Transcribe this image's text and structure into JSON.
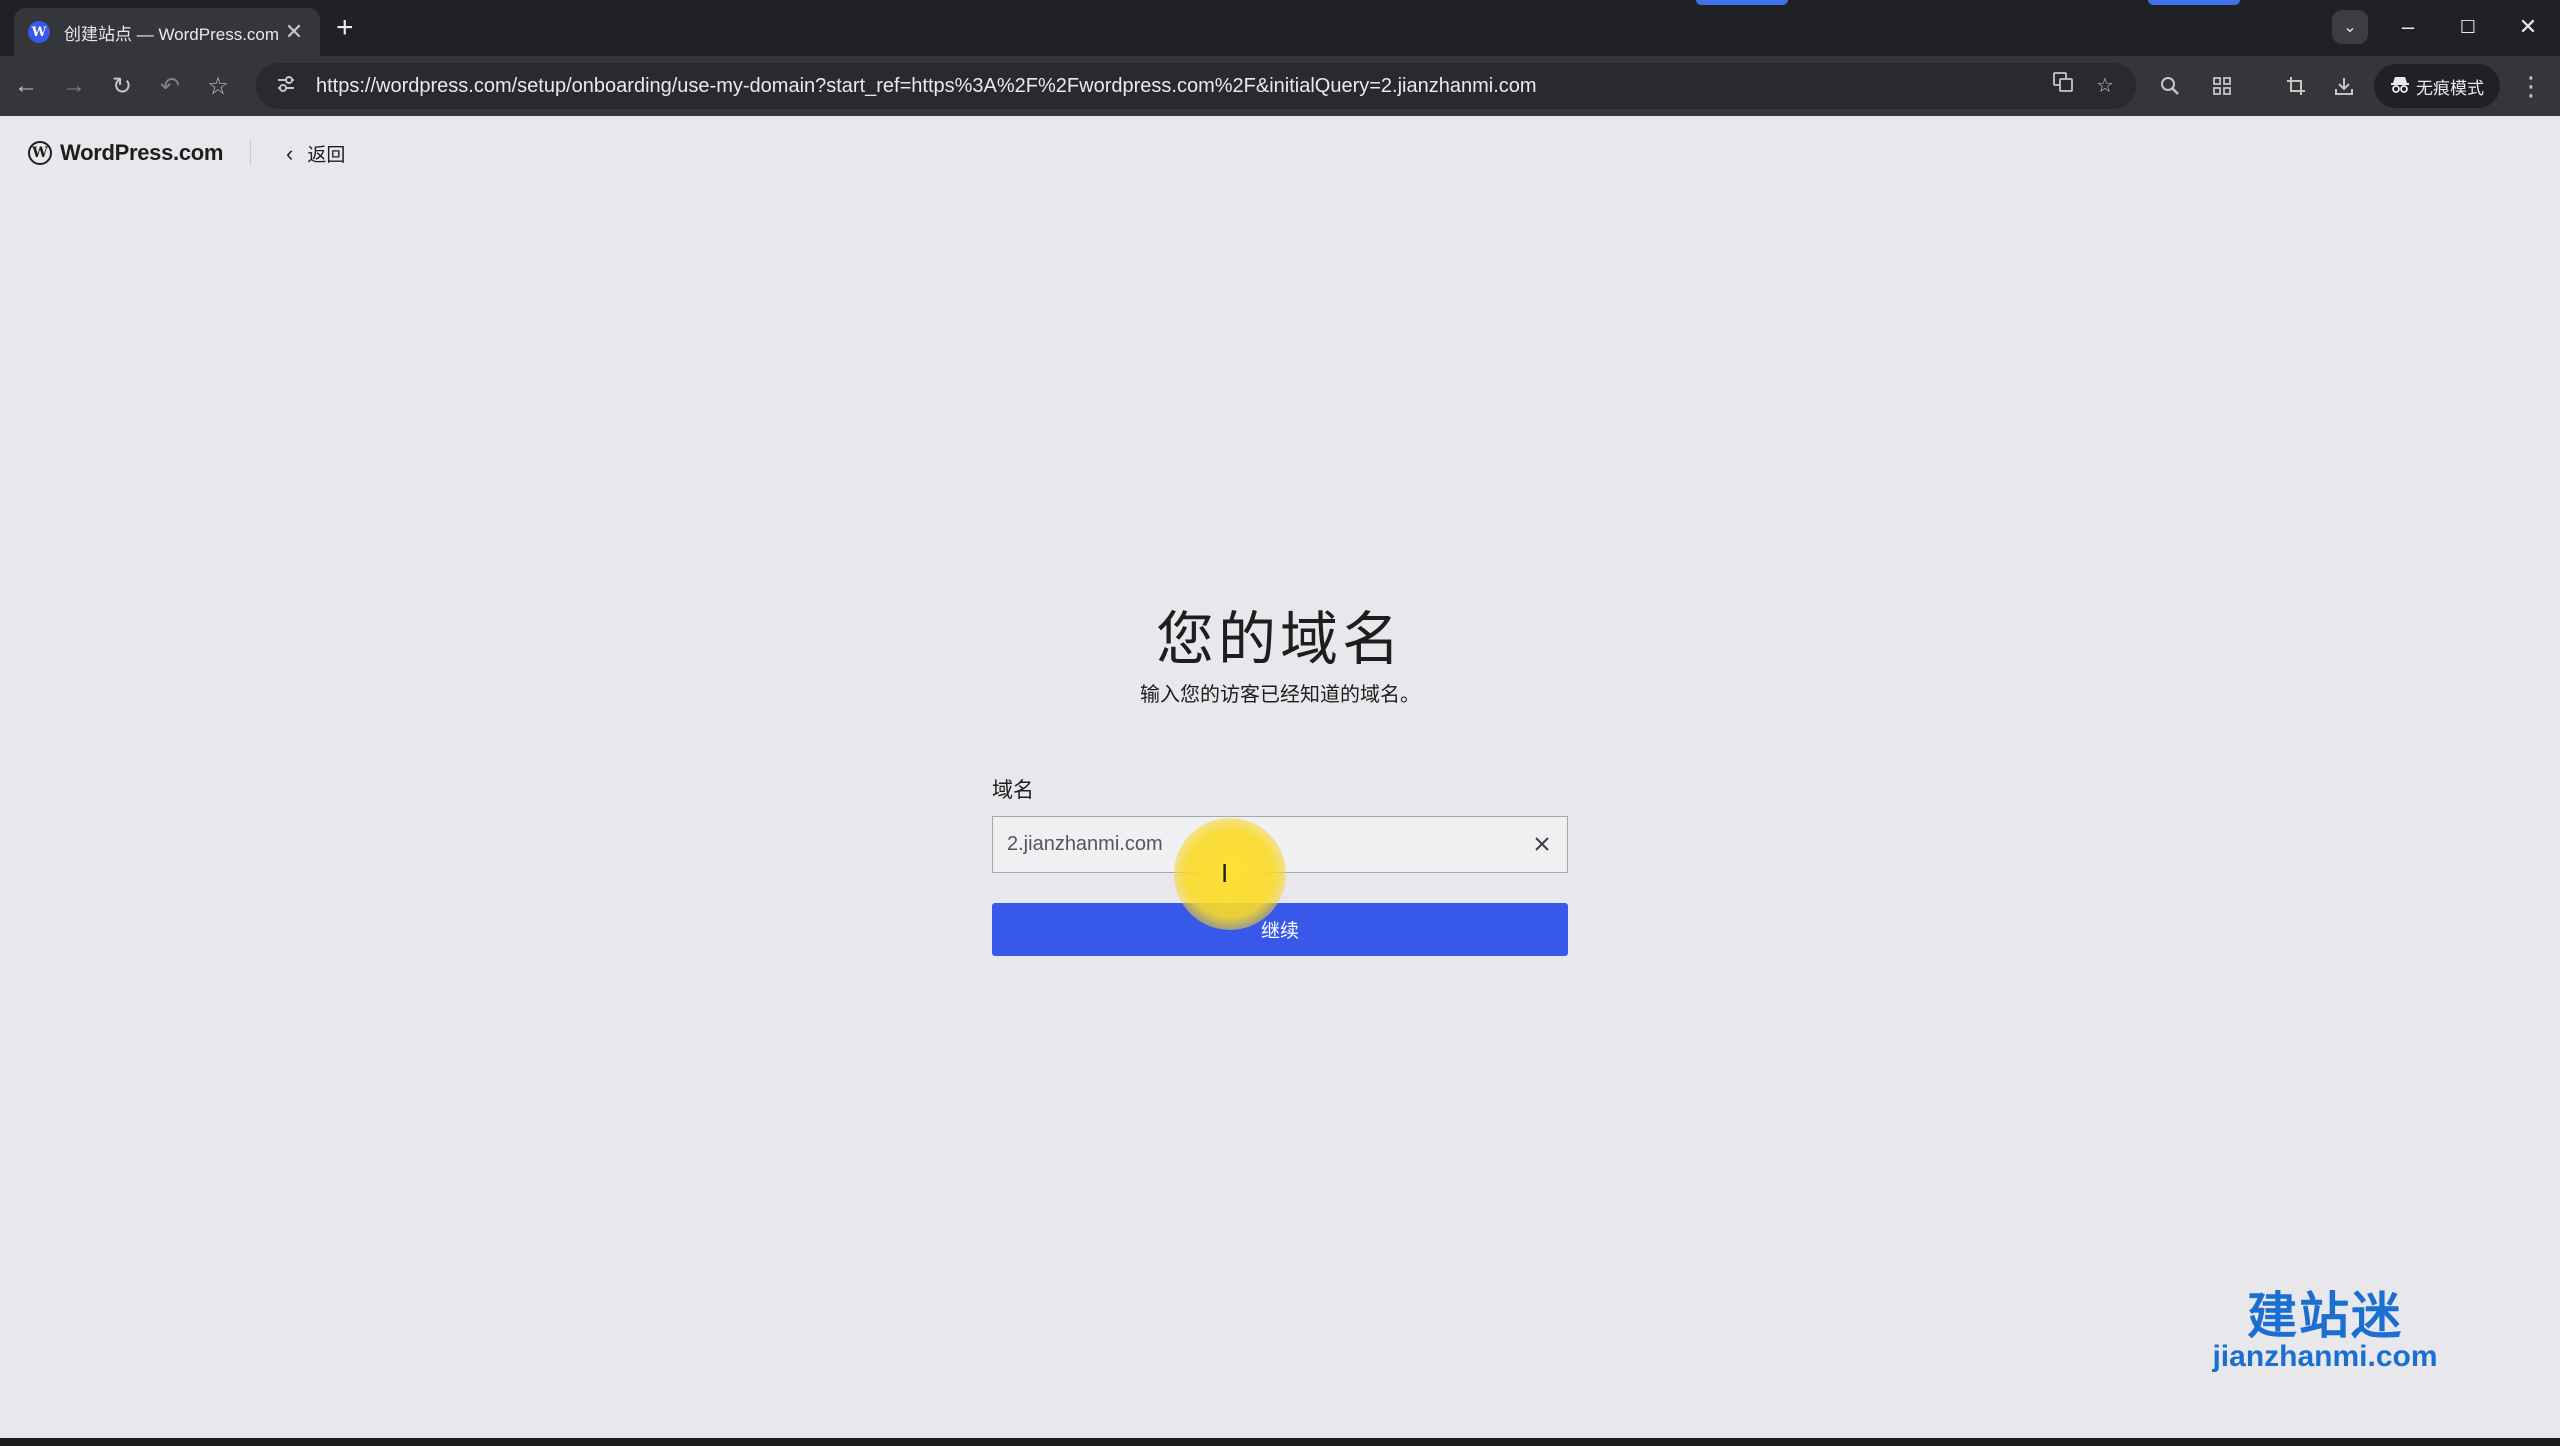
{
  "browser": {
    "tab": {
      "favicon": "W",
      "title": "创建站点 — WordPress.com",
      "close": "✕"
    },
    "new_tab": "+",
    "tab_search": "⌄",
    "window": {
      "minimize": "–",
      "maximize": "☐",
      "close": "✕"
    },
    "nav": {
      "back": "←",
      "forward": "→",
      "reload": "↻",
      "undo": "↶",
      "bookmark": "☆"
    },
    "url": "https://wordpress.com/setup/onboarding/use-my-domain?start_ref=https%3A%2F%2Fwordpress.com%2F&initialQuery=2.jianzhanmi.com",
    "incognito_label": "无痕模式",
    "accent_color": "#3e73e8"
  },
  "header": {
    "brand": "WordPress.com",
    "back_label": "返回"
  },
  "main": {
    "title": "您的域名",
    "subtitle": "输入您的访客已经知道的域名。",
    "field_label": "域名",
    "domain_value": "2.jianzhanmi.com",
    "continue_label": "继续",
    "button_color": "#3858e9"
  },
  "watermark": {
    "cn": "建站迷",
    "en": "jianzhanmi.com"
  }
}
